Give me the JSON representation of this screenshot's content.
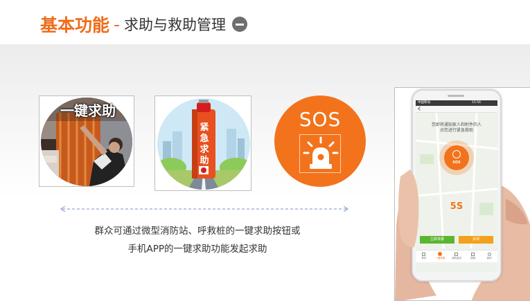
{
  "header": {
    "title_main": "基本功能",
    "title_dash": "-",
    "title_sub": "求助与救助管理"
  },
  "cards": {
    "card1_banner": "一键求助",
    "card2_pillar": [
      "紧",
      "急",
      "求",
      "助"
    ],
    "card3_label": "SOS"
  },
  "description": {
    "line1": "群众可通过微型消防站、呼救桩的一键求助按钮或",
    "line2": "手机APP的一键求助功能发起求助"
  },
  "phone": {
    "status_left": "中国移动",
    "status_time": "15:56",
    "message_line1": "您即将通知家人和附件的人",
    "message_line2": "对您进行紧急救助",
    "sos_label": "SOS",
    "countdown": "5S",
    "btn_call": "立即求援",
    "btn_close": "关闭",
    "nav": [
      "首页",
      "一键求助",
      "消防宣传",
      "视频",
      "我的"
    ]
  },
  "colors": {
    "accent": "#ef6c1a",
    "green": "#5cb531"
  }
}
